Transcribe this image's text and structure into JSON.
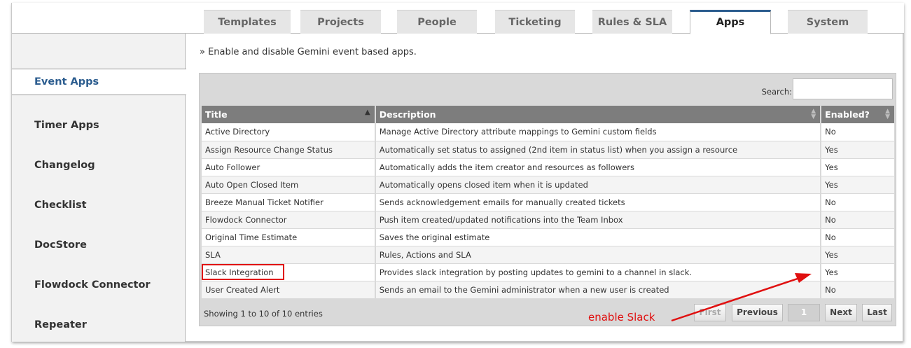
{
  "tabs": [
    {
      "label": "Templates"
    },
    {
      "label": "Projects"
    },
    {
      "label": "People"
    },
    {
      "label": "Ticketing"
    },
    {
      "label": "Rules & SLA"
    },
    {
      "label": "Apps"
    },
    {
      "label": "System"
    }
  ],
  "active_tab": "Apps",
  "sidebar": {
    "items": [
      {
        "label": "Event Apps"
      },
      {
        "label": "Timer Apps"
      },
      {
        "label": "Changelog"
      },
      {
        "label": "Checklist"
      },
      {
        "label": "DocStore"
      },
      {
        "label": "Flowdock Connector"
      },
      {
        "label": "Repeater"
      }
    ],
    "active": "Event Apps"
  },
  "main": {
    "intro": "» Enable and disable Gemini event based apps.",
    "search_label": "Search:",
    "search_value": "",
    "columns": [
      "Title",
      "Description",
      "Enabled?"
    ],
    "rows": [
      [
        "Active Directory",
        "Manage Active Directory attribute mappings to Gemini custom fields",
        "No"
      ],
      [
        "Assign Resource Change Status",
        "Automatically set status to assigned (2nd item in status list) when you assign a resource",
        "Yes"
      ],
      [
        "Auto Follower",
        "Automatically adds the item creator and resources as followers",
        "Yes"
      ],
      [
        "Auto Open Closed Item",
        "Automatically opens closed item when it is updated",
        "Yes"
      ],
      [
        "Breeze Manual Ticket Notifier",
        "Sends acknowledgement emails for manually created tickets",
        "No"
      ],
      [
        "Flowdock Connector",
        "Push item created/updated notifications into the Team Inbox",
        "No"
      ],
      [
        "Original Time Estimate",
        "Saves the original estimate",
        "No"
      ],
      [
        "SLA",
        "Rules, Actions and SLA",
        "Yes"
      ],
      [
        "Slack Integration",
        "Provides slack integration by posting updates to gemini to a channel in slack.",
        "Yes"
      ],
      [
        "User Created Alert",
        "Sends an email to the Gemini administrator when a new user is created",
        "No"
      ]
    ],
    "info": "Showing 1 to 10 of 10 entries",
    "pagination": {
      "first": "First",
      "previous": "Previous",
      "current_page": "1",
      "next": "Next",
      "last": "Last"
    }
  },
  "annotation": {
    "text": "enable Slack",
    "color": "#e01010"
  },
  "colors": {
    "accent": "#2c5d8f",
    "header_bg": "#7d7d7d"
  }
}
